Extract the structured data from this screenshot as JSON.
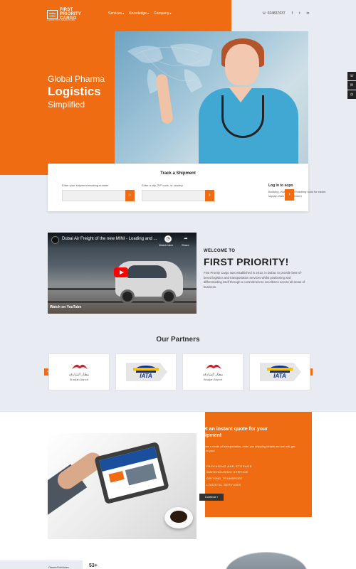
{
  "header": {
    "logo_line1": "FIRST",
    "logo_line2": "PRIORITY",
    "logo_line3": "CARGO",
    "logo_tagline": "LOGISTICS SIMPLIFIED",
    "nav": [
      "Services",
      "Knowledge",
      "Company"
    ],
    "phone": "024837637",
    "social": [
      "f",
      "t",
      "in"
    ]
  },
  "hero": {
    "line1": "Global Pharma",
    "line2": "Logistics",
    "line3": "Simplified"
  },
  "track": {
    "title": "Track a Shipment",
    "label1": "Enter your shipment tracking number",
    "label2": "Enter a city, ZIP code, or country",
    "go": "›",
    "login_title": "Log in to sopo",
    "login_text": "Booking, visibility and tracking tools for easier supply chain management"
  },
  "video": {
    "title": "Dubai Air Freight of the new MINI - Loading and ...",
    "watch_later": "Watch later",
    "share": "Share",
    "watch_on": "Watch on  YouTube"
  },
  "welcome": {
    "small": "WELCOME TO",
    "large": "FIRST PRIORITY!",
    "text": "First Priority Cargo was established in 2013, in Dubai, to provide best-of-breed logistics and transportation services whilst positioning and differentiating itself through a commitment to excellence across all areas of business."
  },
  "partners": {
    "heading": "Our Partners",
    "prev": "‹",
    "next": "›",
    "items": [
      {
        "type": "sharjah",
        "arabic": "مطار الشارقة",
        "english": "Sharjah Airport"
      },
      {
        "type": "iata",
        "text": "IATA"
      },
      {
        "type": "sharjah",
        "arabic": "مطار الشارقة",
        "english": "Sharjah Airport"
      },
      {
        "type": "iata",
        "text": "IATA"
      }
    ]
  },
  "quote": {
    "heading": "Get an instant quote for your shipment",
    "text": "Choose a mode of transportation, enter you shipping details and we will, get back to you!",
    "options": [
      "PACKAGING AND STORAGE",
      "WAREHOUSING SERVICE",
      "GROUND TRANSPORT",
      "LOGISTIC SERVICES"
    ],
    "button": "Continue ›"
  },
  "floating": [
    "☏",
    "✉",
    "◷"
  ],
  "bottom": {
    "label": "Owned Vehicles",
    "number": "53+"
  },
  "colors": {
    "accent": "#ef6c12",
    "background": "#e8ebf2",
    "dark": "#333333"
  }
}
